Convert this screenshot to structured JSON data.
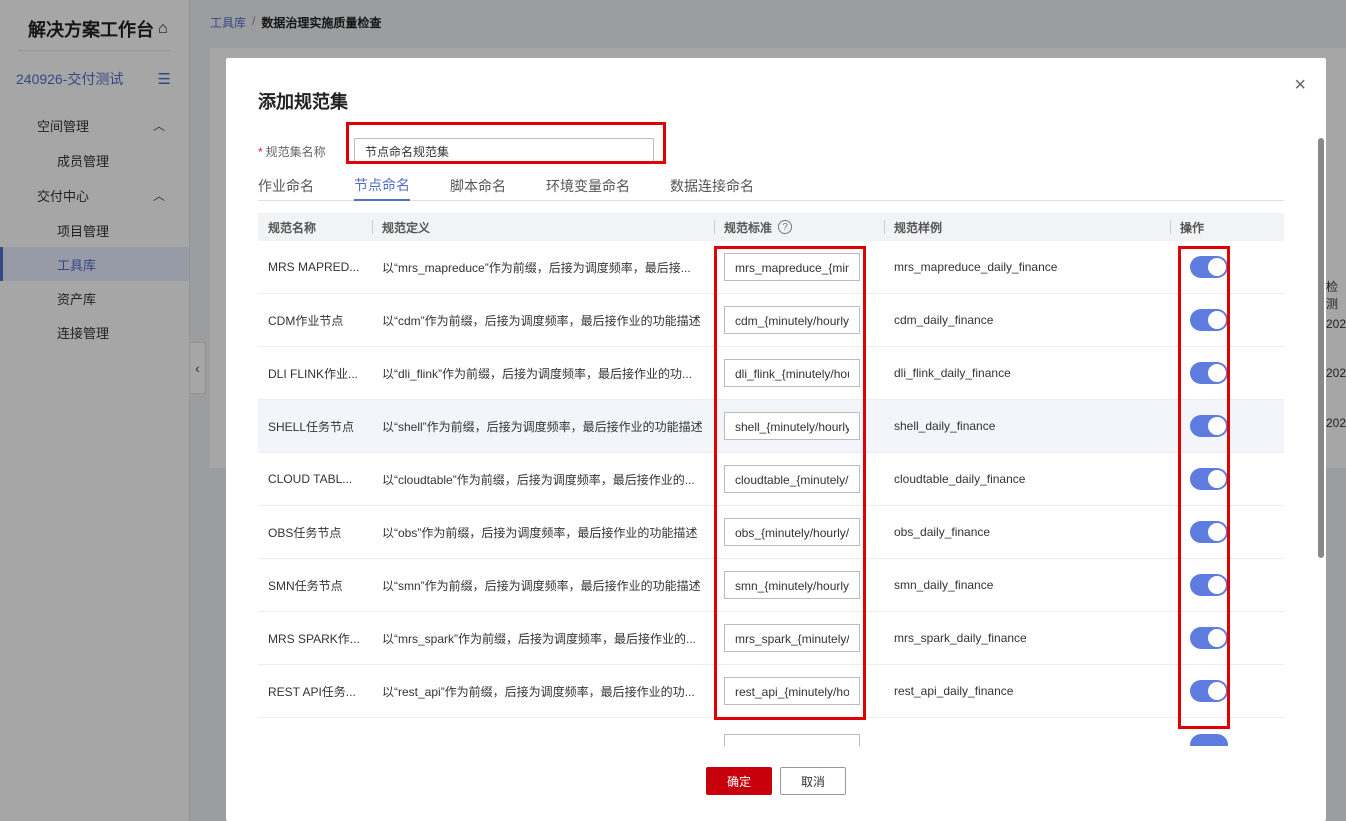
{
  "app": {
    "title": "解决方案工作台"
  },
  "sidebar": {
    "project": "240926-交付测试",
    "groups": [
      {
        "label": "空间管理",
        "items": [
          "成员管理"
        ]
      },
      {
        "label": "交付中心",
        "items": [
          "项目管理",
          "工具库",
          "资产库",
          "连接管理"
        ]
      }
    ],
    "active_item": "工具库"
  },
  "breadcrumb": {
    "root": "工具库",
    "sep": "/",
    "current": "数据治理实施质量检查"
  },
  "background": {
    "col_header_fragment": "检测",
    "cells": [
      "202",
      "202",
      "202"
    ]
  },
  "modal": {
    "title": "添加规范集",
    "close": "×",
    "name_label": "规范集名称",
    "required_mark": "*",
    "name_value": "节点命名规范集",
    "tabs": [
      "作业命名",
      "节点命名",
      "脚本命名",
      "环境变量命名",
      "数据连接命名"
    ],
    "active_tab": "节点命名",
    "columns": {
      "name": "规范名称",
      "definition": "规范定义",
      "standard": "规范标准",
      "example": "规范样例",
      "action": "操作"
    },
    "help_icon": "?",
    "rows": [
      {
        "name": "MRS MAPRED...",
        "definition": "以“mrs_mapreduce”作为前缀，后接为调度频率，最后接...",
        "standard": "mrs_mapreduce_{minutely/hourly/daily}_{功能}",
        "example": "mrs_mapreduce_daily_finance",
        "enabled": true
      },
      {
        "name": "CDM作业节点",
        "definition": "以“cdm”作为前缀，后接为调度频率，最后接作业的功能描述",
        "standard": "cdm_{minutely/hourly/daily}_{功能}",
        "example": "cdm_daily_finance",
        "enabled": true
      },
      {
        "name": "DLI FLINK作业...",
        "definition": "以“dli_flink”作为前缀，后接为调度频率，最后接作业的功...",
        "standard": "dli_flink_{minutely/hourly/daily}_{功能}",
        "example": "dli_flink_daily_finance",
        "enabled": true
      },
      {
        "name": "SHELL任务节点",
        "definition": "以“shell”作为前缀，后接为调度频率，最后接作业的功能描述",
        "standard": "shell_{minutely/hourly/daily}_{功能}",
        "example": "shell_daily_finance",
        "enabled": true
      },
      {
        "name": "CLOUD TABL...",
        "definition": "以“cloudtable”作为前缀，后接为调度频率，最后接作业的...",
        "standard": "cloudtable_{minutely/hourly/daily}_{功能}",
        "example": "cloudtable_daily_finance",
        "enabled": true
      },
      {
        "name": "OBS任务节点",
        "definition": "以“obs”作为前缀，后接为调度频率，最后接作业的功能描述",
        "standard": "obs_{minutely/hourly/daily}_{功能}",
        "example": "obs_daily_finance",
        "enabled": true
      },
      {
        "name": "SMN任务节点",
        "definition": "以“smn”作为前缀，后接为调度频率，最后接作业的功能描述",
        "standard": "smn_{minutely/hourly/daily}_{功能}",
        "example": "smn_daily_finance",
        "enabled": true
      },
      {
        "name": "MRS SPARK作...",
        "definition": "以“mrs_spark”作为前缀，后接为调度频率，最后接作业的...",
        "standard": "mrs_spark_{minutely/hourly/daily}_{功能}",
        "example": "mrs_spark_daily_finance",
        "enabled": true
      },
      {
        "name": "REST API任务...",
        "definition": "以“rest_api”作为前缀，后接为调度频率，最后接作业的功...",
        "standard": "rest_api_{minutely/hourly/daily}_{功能}",
        "example": "rest_api_daily_finance",
        "enabled": true
      }
    ],
    "ok_label": "确定",
    "cancel_label": "取消"
  },
  "colors": {
    "accent": "#526ecc",
    "toggle": "#5e7ce0",
    "primary_button": "#c7000b",
    "highlight_box": "#e00000"
  }
}
